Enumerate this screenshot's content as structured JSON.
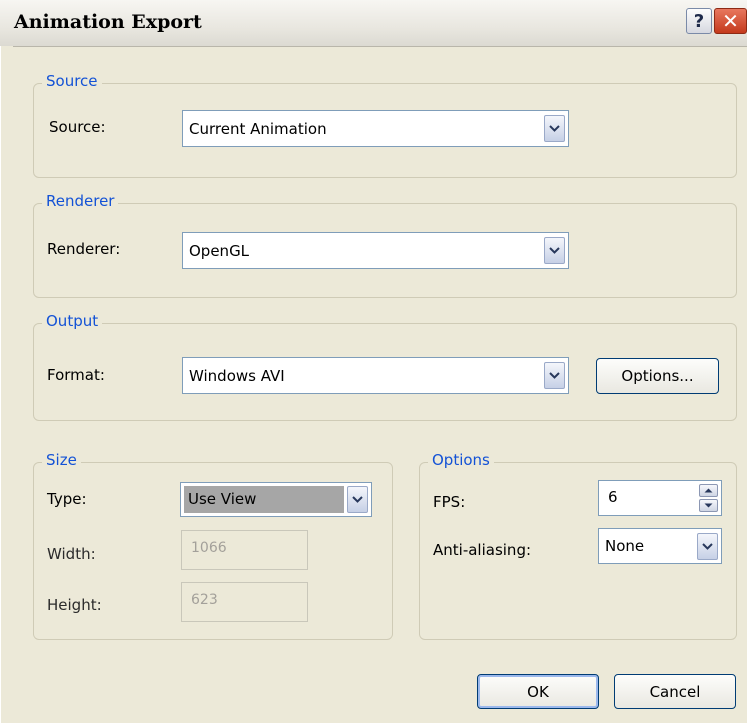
{
  "window": {
    "title": "Animation Export"
  },
  "source": {
    "group_label": "Source",
    "label": "Source:",
    "value": "Current Animation"
  },
  "renderer": {
    "group_label": "Renderer",
    "label": "Renderer:",
    "value": "OpenGL"
  },
  "output": {
    "group_label": "Output",
    "label": "Format:",
    "value": "Windows AVI",
    "options_button": "Options..."
  },
  "size": {
    "group_label": "Size",
    "type_label": "Type:",
    "type_value": "Use View",
    "width_label": "Width:",
    "width_value": "1066",
    "height_label": "Height:",
    "height_value": "623"
  },
  "options": {
    "group_label": "Options",
    "fps_label": "FPS:",
    "fps_value": "6",
    "aa_label": "Anti-aliasing:",
    "aa_value": "None"
  },
  "footer": {
    "ok": "OK",
    "cancel": "Cancel"
  },
  "icons": {
    "help": "help-icon",
    "close": "close-icon",
    "dropdown": "chevron-down-icon",
    "spin_up": "arrow-up-icon",
    "spin_down": "arrow-down-icon"
  }
}
